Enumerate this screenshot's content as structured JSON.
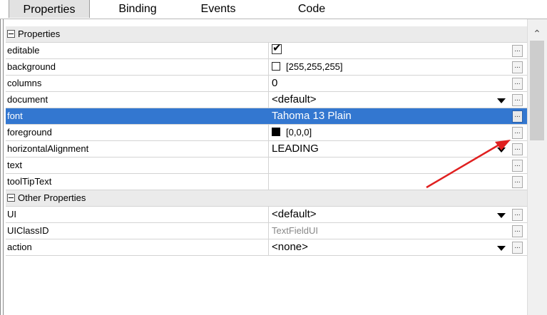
{
  "tabs": [
    {
      "label": "Properties"
    },
    {
      "label": "Binding"
    },
    {
      "label": "Events"
    },
    {
      "label": "Code"
    }
  ],
  "sections": [
    {
      "label": "Properties",
      "rows": [
        {
          "name": "editable",
          "value": "",
          "checkbox": true
        },
        {
          "name": "background",
          "value": "[255,255,255]",
          "swatch": "#ffffff"
        },
        {
          "name": "columns",
          "value": "0"
        },
        {
          "name": "document",
          "value": "<default>",
          "dropdown": true
        },
        {
          "name": "font",
          "value": "Tahoma 13 Plain",
          "selected": true
        },
        {
          "name": "foreground",
          "value": "[0,0,0]",
          "swatch": "#000000"
        },
        {
          "name": "horizontalAlignment",
          "value": "LEADING",
          "dropdown": true
        },
        {
          "name": "text",
          "value": ""
        },
        {
          "name": "toolTipText",
          "value": ""
        }
      ]
    },
    {
      "label": "Other Properties",
      "rows": [
        {
          "name": "UI",
          "value": "<default>",
          "dropdown": true
        },
        {
          "name": "UIClassID",
          "value": "TextFieldUI",
          "muted": true
        },
        {
          "name": "action",
          "value": "<none>",
          "dropdown": true
        }
      ]
    }
  ],
  "ellipsis_label": "...",
  "colors": {
    "selection": "#3377d0",
    "annotation_arrow": "#e02020"
  }
}
